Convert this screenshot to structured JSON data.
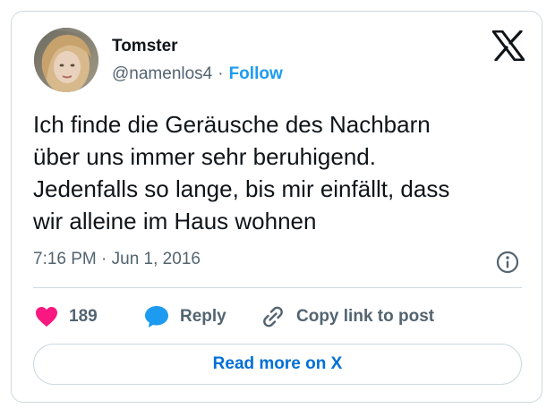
{
  "author": {
    "display_name": "Tomster",
    "handle": "@namenlos4",
    "separator": "·",
    "follow_label": "Follow"
  },
  "tweet": {
    "text": "Ich finde die Geräusche des Nachbarn\nüber uns immer sehr beruhigend.\nJedenfalls so lange, bis mir einfällt, dass\nwir alleine im Haus wohnen",
    "timestamp": "7:16 PM · Jun 1, 2016"
  },
  "actions": {
    "like_count": "189",
    "reply_label": "Reply",
    "copy_link_label": "Copy link to post"
  },
  "read_more_label": "Read more on X",
  "icons": {
    "brand": "x-logo-icon",
    "info": "info-icon",
    "like": "heart-icon",
    "reply": "speech-bubble-icon",
    "copy": "link-icon"
  },
  "colors": {
    "text_primary": "#0f1419",
    "text_secondary": "#536471",
    "follow_blue": "#1d9bf0",
    "read_more_blue": "#006fd6",
    "heart_pink": "#f91880",
    "reply_blue": "#1d9bf0",
    "border": "#cfd9de"
  }
}
